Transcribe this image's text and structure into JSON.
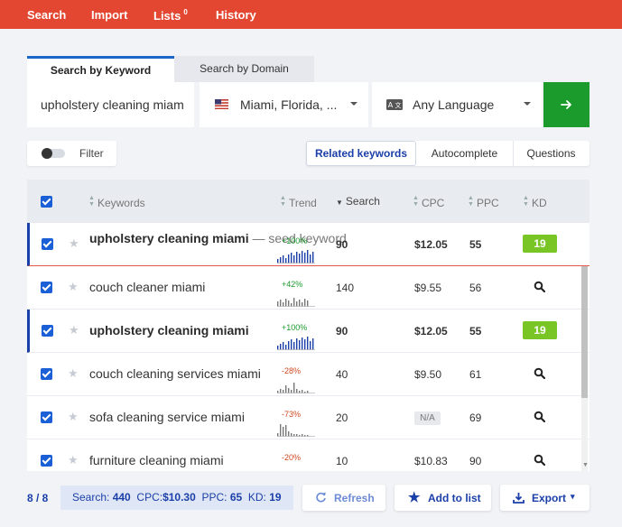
{
  "nav": {
    "search": "Search",
    "import": "Import",
    "lists": "Lists",
    "lists_count": "0",
    "history": "History"
  },
  "tabs": {
    "by_keyword": "Search by Keyword",
    "by_domain": "Search by Domain"
  },
  "search": {
    "keyword_value": "upholstery cleaning miam",
    "location": "Miami, Florida, ...",
    "language": "Any Language"
  },
  "filter": {
    "label": "Filter"
  },
  "modes": {
    "related": "Related keywords",
    "autocomplete": "Autocomplete",
    "questions": "Questions"
  },
  "table": {
    "headers": {
      "keywords": "Keywords",
      "trend": "Trend",
      "search": "Search",
      "cpc": "CPC",
      "ppc": "PPC",
      "kd": "KD"
    },
    "rows": [
      {
        "keyword": "upholstery cleaning miami",
        "seed_note": " — seed keyword",
        "trend": "+100%",
        "search": "90",
        "cpc": "$12.05",
        "ppc": "55",
        "kd": "19"
      },
      {
        "keyword": "couch cleaner miami",
        "trend": "+42%",
        "search": "140",
        "cpc": "$9.55",
        "ppc": "56"
      },
      {
        "keyword": "upholstery cleaning miami",
        "trend": "+100%",
        "search": "90",
        "cpc": "$12.05",
        "ppc": "55",
        "kd": "19"
      },
      {
        "keyword": "couch cleaning services miami",
        "trend": "-28%",
        "search": "40",
        "cpc": "$9.50",
        "ppc": "61"
      },
      {
        "keyword": "sofa cleaning service miami",
        "trend": "-73%",
        "search": "20",
        "cpc": "N/A",
        "ppc": "69"
      },
      {
        "keyword": "furniture cleaning miami",
        "trend": "-20%",
        "search": "10",
        "cpc": "$10.83",
        "ppc": "90"
      }
    ]
  },
  "footer": {
    "count": "8 / 8",
    "summary_search_label": "Search:",
    "summary_search": "440",
    "summary_cpc_label": "CPC:",
    "summary_cpc": "$10.30",
    "summary_ppc_label": "PPC:",
    "summary_ppc": "65",
    "summary_kd_label": "KD:",
    "summary_kd": "19",
    "refresh": "Refresh",
    "add_to_list": "Add to list",
    "export": "Export"
  },
  "colors": {
    "topbar": "#e34732",
    "accent": "#1b3fa8",
    "go_button": "#1c9b2d",
    "kd_easy": "#7ac526"
  }
}
